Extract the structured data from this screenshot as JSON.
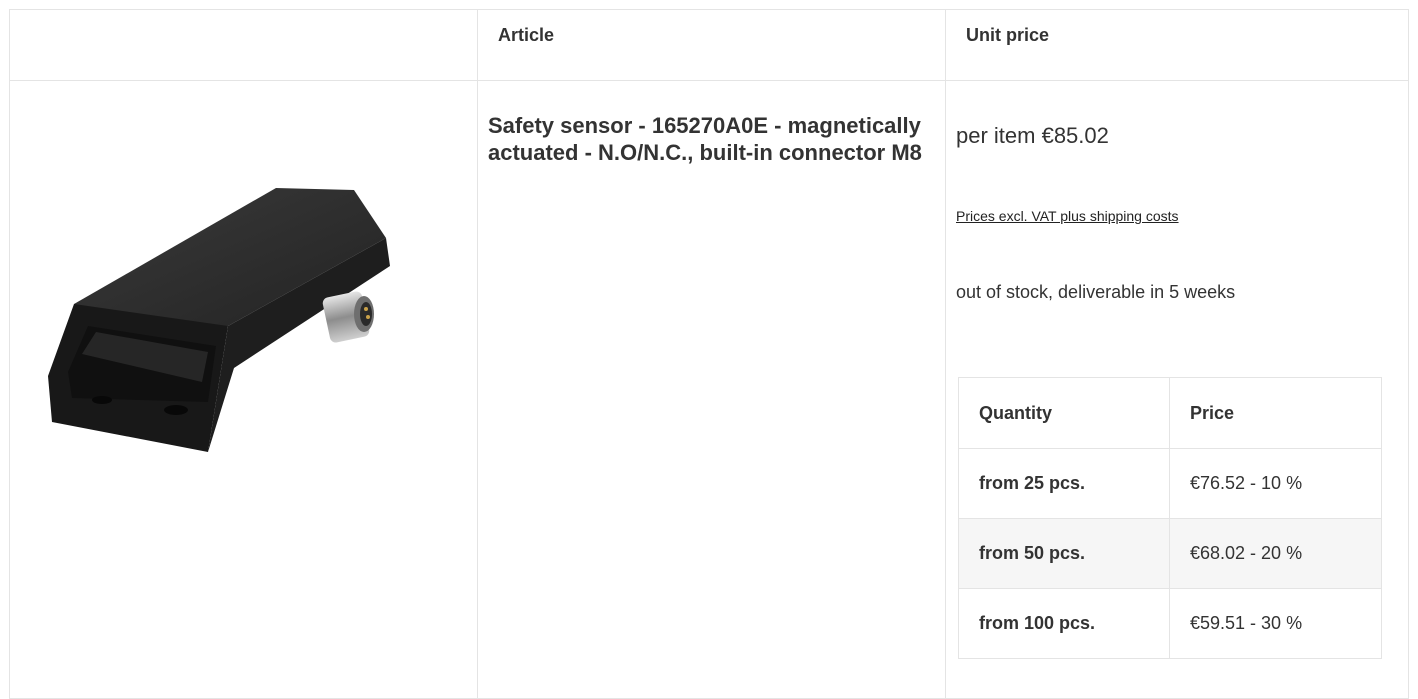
{
  "header": {
    "article_label": "Article",
    "unit_price_label": "Unit price"
  },
  "product": {
    "image_icon": "safety-sensor-image",
    "title": "Safety sensor - 165270A0E - magnetically actuated - N.O/N.C., built-in connector M8",
    "price": "per item €85.02",
    "vat_note": "Prices excl. VAT plus shipping costs",
    "stock": "out of stock, deliverable in 5 weeks"
  },
  "tiers": {
    "quantity_label": "Quantity",
    "price_label": "Price",
    "rows": [
      {
        "quantity": "from 25 pcs.",
        "price": "€76.52 - 10 %"
      },
      {
        "quantity": "from 50 pcs.",
        "price": "€68.02 - 20 %"
      },
      {
        "quantity": "from 100 pcs.",
        "price": "€59.51 - 30 %"
      }
    ]
  }
}
